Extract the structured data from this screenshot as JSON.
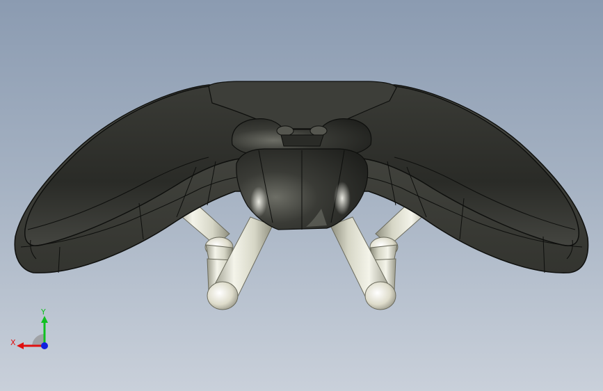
{
  "viewport": {
    "background_top": "#8b9bb1",
    "background_bottom": "#c9d0da"
  },
  "model": {
    "name": "bicycle-saddle",
    "shell_color": "#2f302c",
    "edge_color": "#0e0f0d",
    "rail_color": "#e4e3d4"
  },
  "triad": {
    "x_label": "X",
    "y_label": "Y",
    "x_color": "#e01010",
    "y_color": "#10c020",
    "z_color": "#1020e0"
  }
}
